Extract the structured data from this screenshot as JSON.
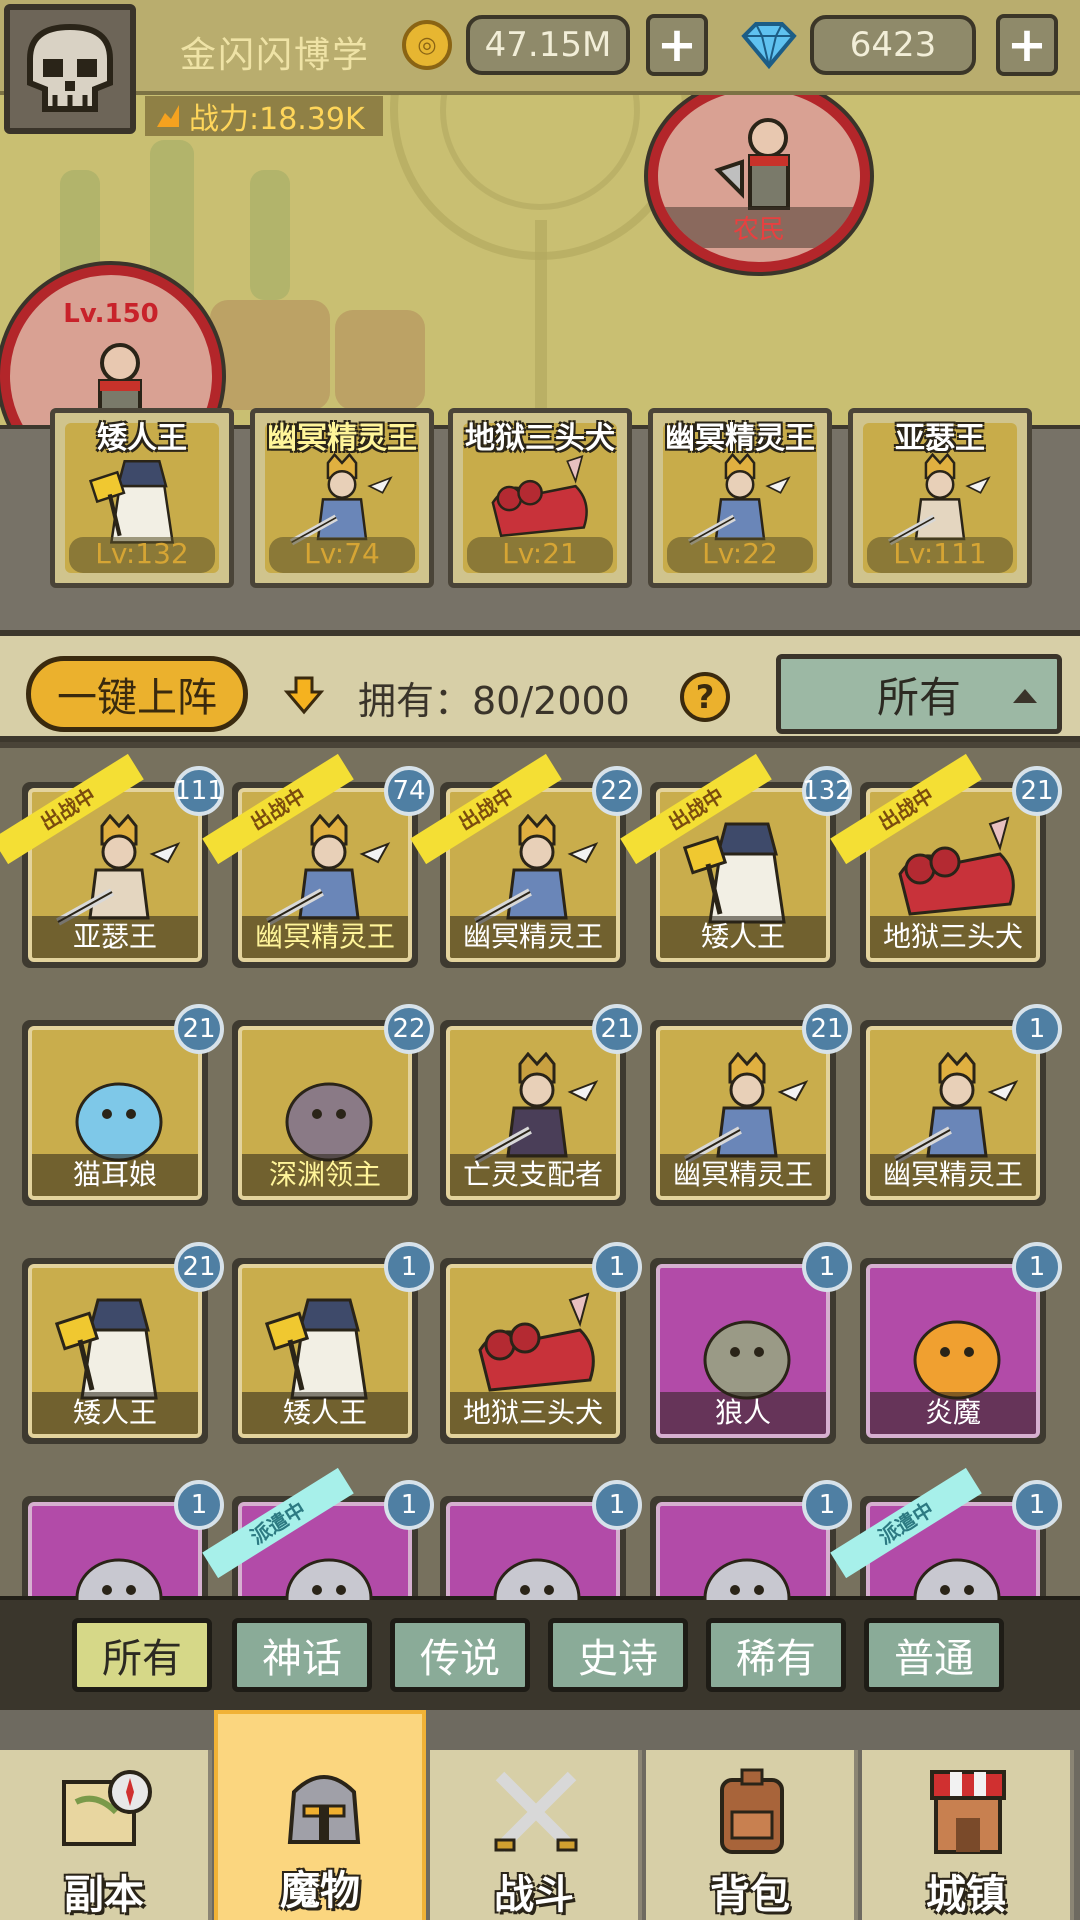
{
  "player": {
    "name": "金闪闪博学",
    "coins": "47.15M",
    "gems": "6423",
    "power": "战力:18.39K"
  },
  "map": {
    "enemy_left": {
      "level": "Lv.150"
    },
    "enemy_top": {
      "tag": "农民"
    }
  },
  "lineup": [
    {
      "name": "矮人王",
      "level": "Lv:132",
      "highlight": false
    },
    {
      "name": "幽冥精灵王",
      "level": "Lv:74",
      "highlight": true
    },
    {
      "name": "地狱三头犬",
      "level": "Lv:21",
      "highlight": false
    },
    {
      "name": "幽冥精灵王",
      "level": "Lv:22",
      "highlight": false
    },
    {
      "name": "亚瑟王",
      "level": "Lv:111",
      "highlight": false
    }
  ],
  "controls": {
    "one_key_label": "一键上阵",
    "owned_text": "拥有：80/2000",
    "help_label": "?",
    "filter_label": "所有"
  },
  "grid": [
    {
      "name": "亚瑟王",
      "count": "111",
      "ribbon": "出战中",
      "rarity": "gold",
      "highlight": false
    },
    {
      "name": "幽冥精灵王",
      "count": "74",
      "ribbon": "出战中",
      "rarity": "gold",
      "highlight": true
    },
    {
      "name": "幽冥精灵王",
      "count": "22",
      "ribbon": "出战中",
      "rarity": "gold",
      "highlight": false
    },
    {
      "name": "矮人王",
      "count": "132",
      "ribbon": "出战中",
      "rarity": "gold",
      "highlight": false
    },
    {
      "name": "地狱三头犬",
      "count": "21",
      "ribbon": "出战中",
      "rarity": "gold",
      "highlight": false
    },
    {
      "name": "猫耳娘",
      "count": "21",
      "ribbon": "",
      "rarity": "gold",
      "highlight": false
    },
    {
      "name": "深渊领主",
      "count": "22",
      "ribbon": "",
      "rarity": "gold",
      "highlight": true
    },
    {
      "name": "亡灵支配者",
      "count": "21",
      "ribbon": "",
      "rarity": "gold",
      "highlight": false
    },
    {
      "name": "幽冥精灵王",
      "count": "21",
      "ribbon": "",
      "rarity": "gold",
      "highlight": false
    },
    {
      "name": "幽冥精灵王",
      "count": "1",
      "ribbon": "",
      "rarity": "gold",
      "highlight": false
    },
    {
      "name": "矮人王",
      "count": "21",
      "ribbon": "",
      "rarity": "gold",
      "highlight": false
    },
    {
      "name": "矮人王",
      "count": "1",
      "ribbon": "",
      "rarity": "gold",
      "highlight": false
    },
    {
      "name": "地狱三头犬",
      "count": "1",
      "ribbon": "",
      "rarity": "gold",
      "highlight": false
    },
    {
      "name": "狼人",
      "count": "1",
      "ribbon": "",
      "rarity": "purple",
      "highlight": false
    },
    {
      "name": "炎魔",
      "count": "1",
      "ribbon": "",
      "rarity": "purple",
      "highlight": false
    },
    {
      "name": "",
      "count": "1",
      "ribbon": "",
      "rarity": "purple",
      "highlight": false
    },
    {
      "name": "",
      "count": "1",
      "ribbon": "派遣中",
      "rarity": "purple",
      "highlight": false
    },
    {
      "name": "",
      "count": "1",
      "ribbon": "",
      "rarity": "purple",
      "highlight": false
    },
    {
      "name": "",
      "count": "1",
      "ribbon": "",
      "rarity": "purple",
      "highlight": false
    },
    {
      "name": "",
      "count": "1",
      "ribbon": "派遣中",
      "rarity": "purple",
      "highlight": false
    }
  ],
  "rarity_tabs": [
    "所有",
    "神话",
    "传说",
    "史诗",
    "稀有",
    "普通"
  ],
  "rarity_active": 0,
  "nav": [
    {
      "label": "副本",
      "icon": "map-compass-icon"
    },
    {
      "label": "魔物",
      "icon": "knight-helmet-icon"
    },
    {
      "label": "战斗",
      "icon": "crossed-swords-icon"
    },
    {
      "label": "背包",
      "icon": "backpack-icon"
    },
    {
      "label": "城镇",
      "icon": "shop-building-icon"
    }
  ],
  "nav_active": 1,
  "colors": {
    "gold_card": "#c9ad4c",
    "purple_card": "#b24ba8",
    "accent_orange": "#ebb12d",
    "badge_blue": "#4f7fa3",
    "ribbon_yellow": "#f4df34",
    "ribbon_cyan": "#a7f0ea"
  }
}
